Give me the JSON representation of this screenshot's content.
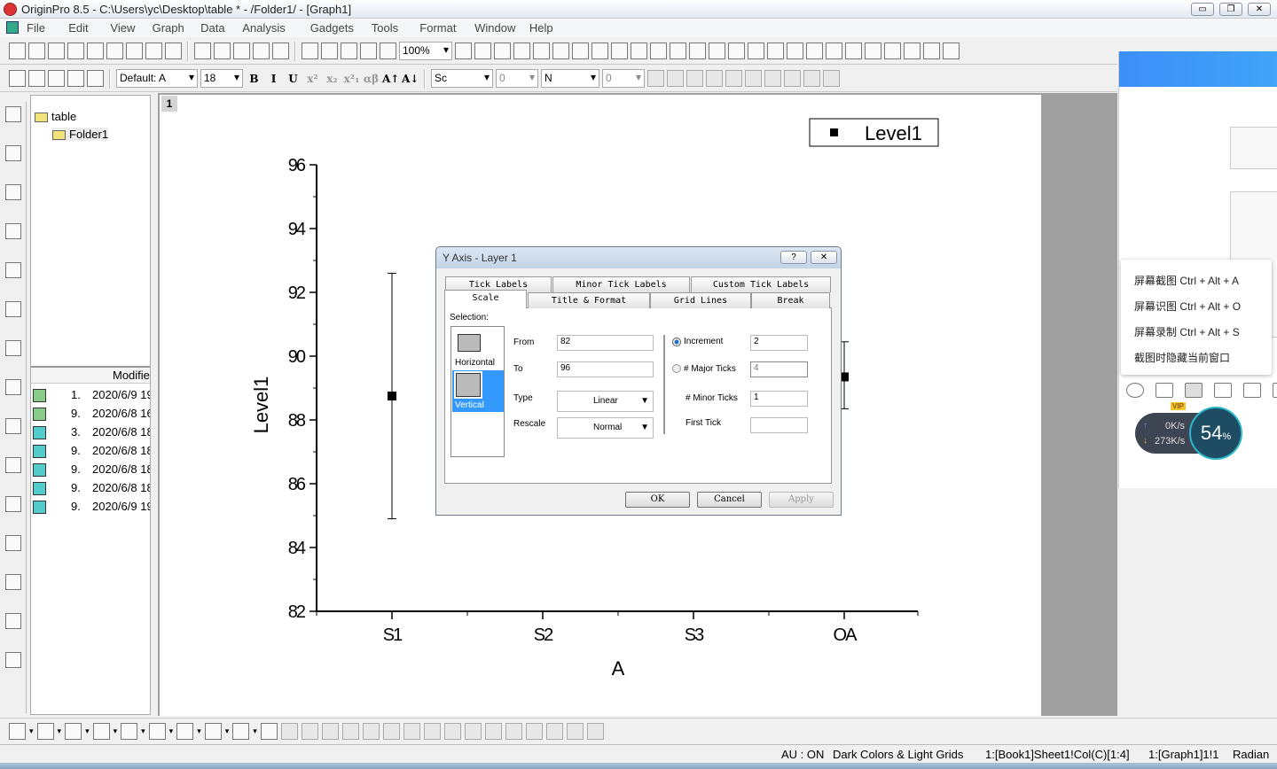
{
  "window": {
    "title": "OriginPro 8.5 - C:\\Users\\yc\\Desktop\\table * - /Folder1/ - [Graph1]",
    "minimize": "▭",
    "restore": "❐",
    "close": "✕"
  },
  "menu": [
    "File",
    "Edit",
    "View",
    "Graph",
    "Data",
    "Analysis",
    "Gadgets",
    "Tools",
    "Format",
    "Window",
    "Help"
  ],
  "toolbar1": {
    "icons_a": [
      "new-project-icon",
      "new-workbook-icon",
      "new-matrix-icon",
      "new-excel-icon",
      "new-graph-icon",
      "new-matrix-book-icon",
      "new-function-icon",
      "new-layout-icon",
      "new-notes-icon"
    ],
    "icons_b": [
      "open-icon",
      "open-template-icon",
      "open-excel-icon",
      "save-project-icon",
      "save-template-icon"
    ],
    "icons_c": [
      "import-wizard-icon",
      "import-ascii-icon",
      "import-multiple-icon",
      "duplicate-icon",
      "recalculate-icon"
    ],
    "zoom": "100%",
    "icons_d": [
      "print-icon",
      "export-icon",
      "copy-page-icon",
      "code-builder-icon",
      "results-log-icon",
      "project-explorer-icon",
      "object-manager-icon",
      "script-window-icon",
      "command-window-icon",
      "plot-setup-icon",
      "add-layer-icon",
      "rescale-icon",
      "merge-graph-icon",
      "arrange-layers-icon",
      "extract-layer-icon",
      "axes-bottom-left-icon",
      "axes-frame-icon",
      "axes-left-right-icon",
      "axes-box-icon",
      "axes-broken-icon",
      "axes-color-icon",
      "layer-contents-icon",
      "new-legend-icon",
      "layer-info-icon",
      "timestamp-icon",
      "table-icon"
    ]
  },
  "toolbar2": {
    "icons_a": [
      "edit-icon",
      "bring-data-icon",
      "worksheet-icon",
      "mask-icon",
      "unmask-icon"
    ],
    "font": "Default: A",
    "font_size": "18",
    "format": [
      "B",
      "I",
      "U",
      "x²",
      "x₂",
      "x²₁",
      "αβ",
      "A↑",
      "A↓"
    ],
    "line_style": "Sc",
    "line_width": "0",
    "fill": "N",
    "fill_width": "0",
    "icons_b": [
      "fill-color-icon",
      "line-color-icon",
      "pattern-icon",
      "grid-icon",
      "layout-icon",
      "mask-m-icon",
      "remove-icon",
      "increase-icon",
      "decrease-icon",
      "lock-icon"
    ]
  },
  "left_tools": [
    "pointer-icon",
    "zoom-in-icon",
    "zoom-out-icon",
    "data-reader-icon",
    "screen-reader-icon",
    "data-selector-icon",
    "draw-data-icon",
    "region-select-icon",
    "mask-points-icon",
    "text-tool-icon",
    "arrow-tool-icon",
    "line-tool-icon",
    "rectangle-tool-icon",
    "hand-icon",
    "equation-icon"
  ],
  "explorer": {
    "root": "table",
    "folder": "Folder1",
    "column_header": "Modifie",
    "rows": [
      {
        "n": "1.",
        "d": "2020/6/9 19"
      },
      {
        "n": "9.",
        "d": "2020/6/8 16"
      },
      {
        "n": "3.",
        "d": "2020/6/8 18"
      },
      {
        "n": "9.",
        "d": "2020/6/8 18"
      },
      {
        "n": "9.",
        "d": "2020/6/8 18"
      },
      {
        "n": "9.",
        "d": "2020/6/8 18"
      },
      {
        "n": "9.",
        "d": "2020/6/9 19"
      }
    ]
  },
  "layer_number": "1",
  "chart_data": {
    "type": "scatter",
    "xlabel": "A",
    "ylabel": "Level1",
    "categories": [
      "S1",
      "S2",
      "S3",
      "OA"
    ],
    "ylim": [
      82,
      96
    ],
    "yticks": [
      "82",
      "84",
      "86",
      "88",
      "90",
      "92",
      "94",
      "96"
    ],
    "legend": {
      "label": "Level1",
      "placement": "top-right"
    },
    "series": [
      {
        "name": "Level1",
        "points": [
          {
            "x": "S1",
            "y": 88.75,
            "err_low": 84.9,
            "err_high": 92.6
          },
          {
            "x": "OA",
            "y": 89.35,
            "err_low": 88.35,
            "err_high": 90.45
          }
        ]
      }
    ]
  },
  "dialog": {
    "title": "Y Axis - Layer 1",
    "help": "?",
    "close": "✕",
    "tabs_row1": [
      "Tick Labels",
      "Minor Tick Labels",
      "Custom Tick Labels"
    ],
    "tabs_row2": [
      "Scale",
      "Title & Format",
      "Grid Lines",
      "Break"
    ],
    "selection_label": "Selection:",
    "sel_horizontal": "Horizontal",
    "sel_vertical": "Vertical",
    "from_label": "From",
    "from": "82",
    "to_label": "To",
    "to": "96",
    "type_label": "Type",
    "type": "Linear",
    "rescale_label": "Rescale",
    "rescale": "Normal",
    "increment_label": "Increment",
    "increment": "2",
    "major_label": "# Major Ticks",
    "major": "4",
    "minor_label": "# Minor Ticks",
    "minor": "1",
    "first_label": "First Tick",
    "first": "",
    "ok": "OK",
    "cancel": "Cancel",
    "apply": "Apply"
  },
  "screenshot_tool": {
    "menu": [
      "屏幕截图 Ctrl + Alt + A",
      "屏幕识图 Ctrl + Alt + O",
      "屏幕录制 Ctrl + Alt + S",
      "截图时隐藏当前窗口"
    ],
    "icons": [
      "emoji-icon",
      "gif-icon",
      "scissors-icon",
      "folder-icon",
      "puzzle-icon",
      "image-icon"
    ],
    "badge": "VIP",
    "up": "0K/s",
    "down": "273K/s",
    "percent": "54",
    "percent_unit": "%"
  },
  "bottom_toolbar": [
    "line-plot-icon",
    "scatter-plot-icon",
    "line-symbol-icon",
    "column-plot-icon",
    "3d-plot-icon",
    "error-bar-icon",
    "area-icon",
    "polar-icon",
    "box-chart-icon",
    "template-icon",
    "group-icon",
    "ungroup-icon",
    "front-icon",
    "back-icon",
    "align-left-icon",
    "align-right-icon",
    "align-top-icon",
    "align-bottom-icon",
    "center-icon",
    "middle-icon",
    "same-width-icon",
    "same-height-icon",
    "distribute-icon",
    "spread-icon",
    "snap-icon",
    "frame-icon"
  ],
  "status": {
    "au": "AU : ON",
    "theme": "Dark Colors & Light Grids",
    "data": "1:[Book1]Sheet1!Col(C)[1:4]",
    "graph": "1:[Graph1]1!1",
    "angle": "Radian"
  }
}
